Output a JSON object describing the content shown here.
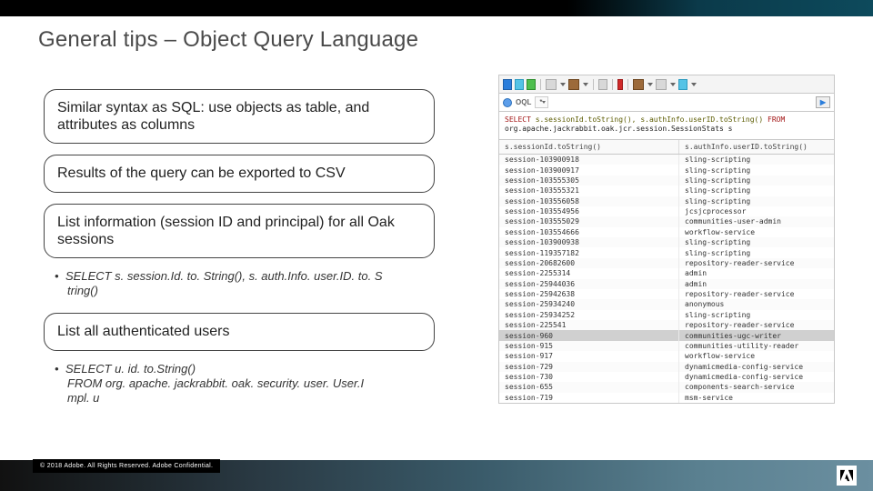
{
  "title": "General tips – Object Query Language",
  "pills": {
    "p1": "Similar syntax as SQL: use objects as table, and attributes as columns",
    "p2": "Results of the query can be exported to CSV",
    "p3": "List information (session ID and principal) for all Oak sessions",
    "p4": "List all authenticated users"
  },
  "bullets": {
    "b1_l1": "SELECT s. session.Id. to. String(), s. auth.Info. user.ID. to. S",
    "b1_l2": "tring()",
    "b2_l1": "SELECT u. id. to.String()",
    "b2_l2": "FROM org. apache. jackrabbit. oak. security. user. User.I",
    "b2_l3": "mpl. u"
  },
  "copyright": "© 2018 Adobe. All Rights Reserved. Adobe Confidential.",
  "oql": {
    "label": "OQL",
    "dropdown": "*",
    "query_kw_select": "SELECT",
    "query_line1_rest": " s.sessionId.toString(), s.authInfo.userID.toString() ",
    "query_kw_from": "FROM",
    "query_line2": "org.apache.jackrabbit.oak.jcr.session.SessionStats s",
    "headers": {
      "a": "s.sessionId.toString()",
      "b": "s.authInfo.userID.toString()"
    }
  },
  "rows": [
    {
      "a": "session-103900918",
      "b": "sling-scripting"
    },
    {
      "a": "session-103900917",
      "b": "sling-scripting"
    },
    {
      "a": "session-103555305",
      "b": "sling-scripting"
    },
    {
      "a": "session-103555321",
      "b": "sling-scripting"
    },
    {
      "a": "session-103556058",
      "b": "sling-scripting"
    },
    {
      "a": "session-103554956",
      "b": "jcsjcprocessor"
    },
    {
      "a": "session-103555029",
      "b": "communities-user-admin"
    },
    {
      "a": "session-103554666",
      "b": "workflow-service"
    },
    {
      "a": "session-103900938",
      "b": "sling-scripting"
    },
    {
      "a": "session-119357182",
      "b": "sling-scripting"
    },
    {
      "a": "session-20682600",
      "b": "repository-reader-service"
    },
    {
      "a": "session-2255314",
      "b": "admin"
    },
    {
      "a": "session-25944036",
      "b": "admin"
    },
    {
      "a": "session-25942638",
      "b": "repository-reader-service"
    },
    {
      "a": "session-25934240",
      "b": "anonymous"
    },
    {
      "a": "session-25934252",
      "b": "sling-scripting"
    },
    {
      "a": "session-225541",
      "b": "repository-reader-service"
    },
    {
      "a": "session-960",
      "b": "communities-ugc-writer",
      "sel": true
    },
    {
      "a": "session-915",
      "b": "communities-utility-reader"
    },
    {
      "a": "session-917",
      "b": "workflow-service"
    },
    {
      "a": "session-729",
      "b": "dynamicmedia-config-service"
    },
    {
      "a": "session-730",
      "b": "dynamicmedia-config-service"
    },
    {
      "a": "session-655",
      "b": "components-search-service"
    },
    {
      "a": "session-719",
      "b": "msm-service"
    }
  ]
}
